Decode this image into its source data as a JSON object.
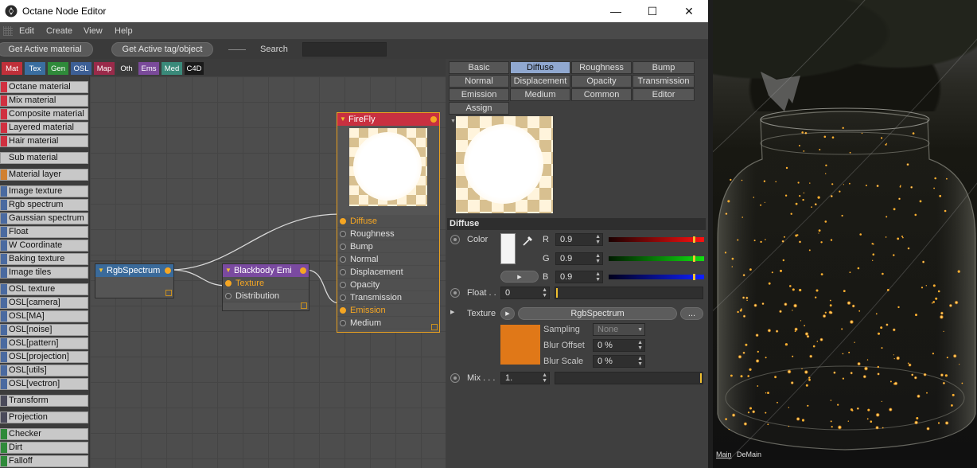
{
  "window": {
    "title": "Octane Node Editor",
    "controls": {
      "minimize": "—",
      "maximize": "☐",
      "close": "✕"
    }
  },
  "menu": [
    "Edit",
    "Create",
    "View",
    "Help"
  ],
  "toolbar": {
    "get_active_material": "Get Active material",
    "get_active_tag": "Get Active tag/object",
    "search_label": "Search",
    "search_value": ""
  },
  "category_tabs": [
    {
      "label": "Mat",
      "color": "#c0303a"
    },
    {
      "label": "Tex",
      "color": "#3a6ea0"
    },
    {
      "label": "Gen",
      "color": "#2f8a3a"
    },
    {
      "label": "OSL",
      "color": "#3d5f95"
    },
    {
      "label": "Map",
      "color": "#9a2a4a"
    },
    {
      "label": "Oth",
      "color": "#3a3a3a"
    },
    {
      "label": "Ems",
      "color": "#7a4a9a"
    },
    {
      "label": "Med",
      "color": "#3a8a7a"
    },
    {
      "label": "C4D",
      "color": "#1a1a1a"
    }
  ],
  "palette": [
    {
      "label": "Octane material",
      "color": "#d03040"
    },
    {
      "label": "Mix material",
      "color": "#d03040"
    },
    {
      "label": "Composite material",
      "color": "#d03040"
    },
    {
      "label": "Layered material",
      "color": "#d03040"
    },
    {
      "label": "Hair material",
      "color": "#d03040"
    },
    {
      "label": "Sub material",
      "color": "#c8c8c8"
    },
    {
      "label": "Material layer",
      "color": "#d08030"
    },
    {
      "label": "Image texture",
      "color": "#4a6aa0"
    },
    {
      "label": "Rgb spectrum",
      "color": "#4a6aa0"
    },
    {
      "label": "Gaussian spectrum",
      "color": "#4a6aa0"
    },
    {
      "label": "Float",
      "color": "#4a6aa0"
    },
    {
      "label": "W Coordinate",
      "color": "#4a6aa0"
    },
    {
      "label": "Baking texture",
      "color": "#4a6aa0"
    },
    {
      "label": "Image tiles",
      "color": "#4a6aa0"
    },
    {
      "label": "OSL texture",
      "color": "#4a6aa0"
    },
    {
      "label": "OSL[camera]",
      "color": "#4a6aa0"
    },
    {
      "label": "OSL[MA]",
      "color": "#4a6aa0"
    },
    {
      "label": "OSL[noise]",
      "color": "#4a6aa0"
    },
    {
      "label": "OSL[pattern]",
      "color": "#4a6aa0"
    },
    {
      "label": "OSL[projection]",
      "color": "#4a6aa0"
    },
    {
      "label": "OSL[utils]",
      "color": "#4a6aa0"
    },
    {
      "label": "OSL[vectron]",
      "color": "#4a6aa0"
    },
    {
      "label": "Transform",
      "color": "#4a4a5a"
    },
    {
      "label": "Projection",
      "color": "#4a4a5a"
    },
    {
      "label": "Checker",
      "color": "#2f8a3a"
    },
    {
      "label": "Dirt",
      "color": "#2f8a3a"
    },
    {
      "label": "Falloff",
      "color": "#2f8a3a"
    }
  ],
  "nodes": {
    "rgb": {
      "title": "RgbSpectrum",
      "color": "#3a6a9a"
    },
    "blackbody": {
      "title": "Blackbody Emi",
      "color": "#7a4aa0",
      "inputs": [
        "Texture",
        "Distribution"
      ]
    },
    "firefly": {
      "title": "FireFly",
      "color": "#c83040",
      "inputs": [
        "Diffuse",
        "Roughness",
        "Bump",
        "Normal",
        "Displacement",
        "Opacity",
        "Transmission",
        "Emission",
        "Medium"
      ]
    }
  },
  "attr": {
    "tabs": [
      [
        "Basic",
        "Diffuse",
        "Roughness",
        "Bump"
      ],
      [
        "Normal",
        "Displacement",
        "Opacity",
        "Transmission"
      ],
      [
        "Emission",
        "Medium",
        "Common",
        "Editor"
      ],
      [
        "Assign"
      ]
    ],
    "active_tab": "Diffuse",
    "section": "Diffuse",
    "color_label": "Color",
    "r_label": "R",
    "r_value": "0.9",
    "g_label": "G",
    "g_value": "0.9",
    "b_label": "B",
    "b_value": "0.9",
    "color_level": 0.9,
    "float_label": "Float . .",
    "float_value": "0",
    "texture_label": "Texture",
    "texture_value": "RgbSpectrum",
    "more_button": "...",
    "texture_swatch": "#e07818",
    "sampling_label": "Sampling",
    "sampling_value": "None",
    "blur_offset_label": "Blur Offset",
    "blur_offset_value": "0 %",
    "blur_scale_label": "Blur Scale",
    "blur_scale_value": "0 %",
    "mix_label": "Mix . . .",
    "mix_value": "1."
  },
  "viewport": {
    "tabs": [
      "Main",
      "DeMain"
    ]
  }
}
